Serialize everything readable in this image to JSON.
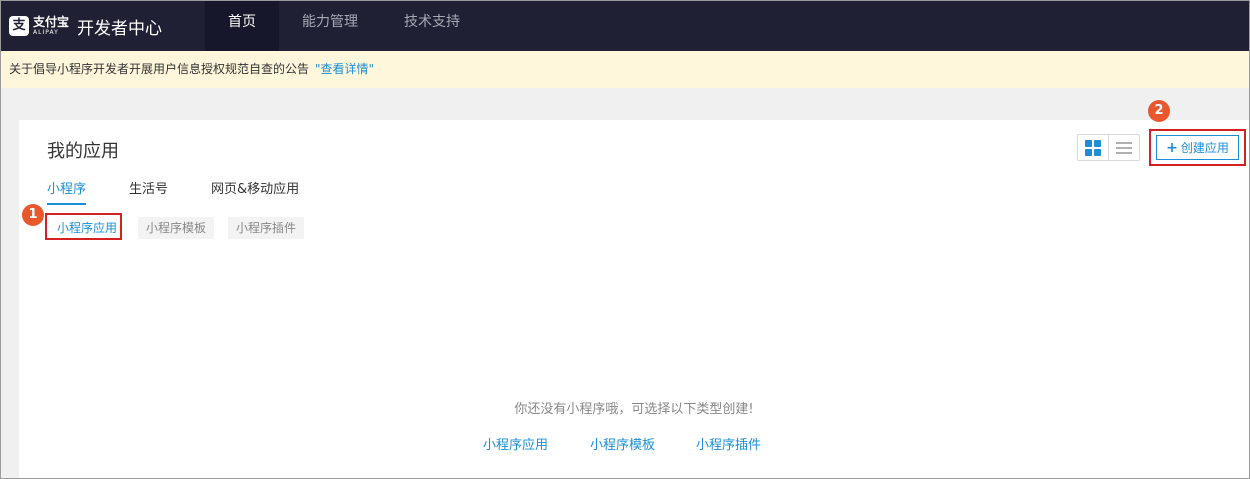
{
  "header": {
    "logo_cn": "支付宝",
    "logo_en": "ALIPAY",
    "logo_mark": "支",
    "title": "开发者中心",
    "nav": [
      {
        "label": "首页",
        "active": true
      },
      {
        "label": "能力管理",
        "active": false
      },
      {
        "label": "技术支持",
        "active": false
      }
    ]
  },
  "notice": {
    "text": "关于倡导小程序开发者开展用户信息授权规范自查的公告",
    "link": "\"查看详情\""
  },
  "main": {
    "title": "我的应用",
    "tabs": [
      {
        "label": "小程序",
        "active": true
      },
      {
        "label": "生活号",
        "active": false
      },
      {
        "label": "网页&移动应用",
        "active": false
      }
    ],
    "subtabs": [
      {
        "label": "小程序应用",
        "active": true
      },
      {
        "label": "小程序模板",
        "active": false
      },
      {
        "label": "小程序插件",
        "active": false
      }
    ],
    "create_button": "创建应用",
    "create_icon": "+",
    "view_toggle": {
      "grid_icon": "grid-icon",
      "list_icon": "list-icon",
      "selected": "grid"
    },
    "empty_message": "你还没有小程序哦，可选择以下类型创建!",
    "empty_links": [
      "小程序应用",
      "小程序模板",
      "小程序插件"
    ]
  },
  "annotations": {
    "badge_1": "1",
    "badge_2": "2"
  },
  "colors": {
    "accent": "#1a8fd8",
    "topbar": "#1f2033",
    "notice_bg": "#fff7dc",
    "highlight": "#d42020",
    "badge": "#e8582c"
  }
}
